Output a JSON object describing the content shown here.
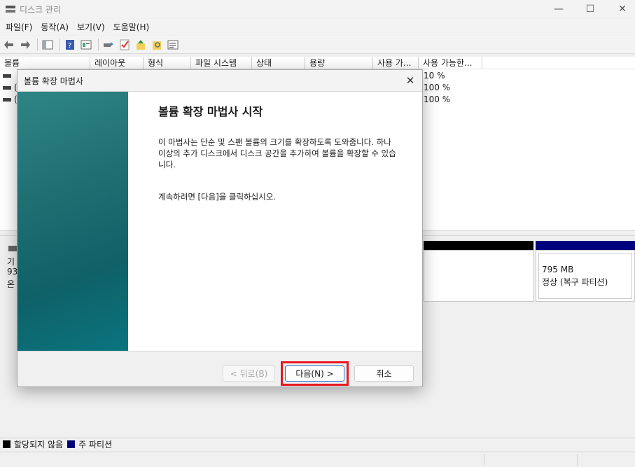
{
  "window": {
    "title": "디스크 관리",
    "minimize": "—",
    "maximize": "☐",
    "close": "✕"
  },
  "menu": [
    "파일(F)",
    "동작(A)",
    "보기(V)",
    "도움말(H)"
  ],
  "toolbar": {
    "icons": [
      "back-arrow-icon",
      "forward-arrow-icon",
      "console-tree-icon",
      "help-icon",
      "properties-icon",
      "rescan-icon",
      "check-icon",
      "up-icon",
      "wizard-icon",
      "list-icon"
    ]
  },
  "volumes": {
    "columns": [
      "볼륨",
      "레이아웃",
      "형식",
      "파일 시스템",
      "상태",
      "용량",
      "사용 가...",
      "사용 가능한..."
    ],
    "rows": [
      {
        "paren": "",
        "pct": "10 %"
      },
      {
        "paren": "(",
        "pct": "100 %"
      },
      {
        "paren": "(",
        "pct": "100 %"
      }
    ]
  },
  "disk": {
    "label_lines": [
      "기",
      "93",
      "온"
    ],
    "partition_right": {
      "size": "795 MB",
      "status": "정상 (복구 파티션)"
    }
  },
  "legend": [
    {
      "label": "할당되지 않음",
      "color": "#000000"
    },
    {
      "label": "주 파티션",
      "color": "#00007c"
    }
  ],
  "dialog": {
    "title": "볼륨 확장 마법사",
    "heading": "볼륨 확장 마법사 시작",
    "description": "이 마법사는 단순 및 스팬 볼륨의 크기를 확장하도록 도와줍니다. 하나 이상의 추가 디스크에서 디스크 공간을 추가하여 볼륨을 확장할 수 있습니다.",
    "instruction": "계속하려면 [다음]을 클릭하십시오.",
    "buttons": {
      "back": "< 뒤로(B)",
      "next": "다음(N) >",
      "cancel": "취소"
    }
  }
}
